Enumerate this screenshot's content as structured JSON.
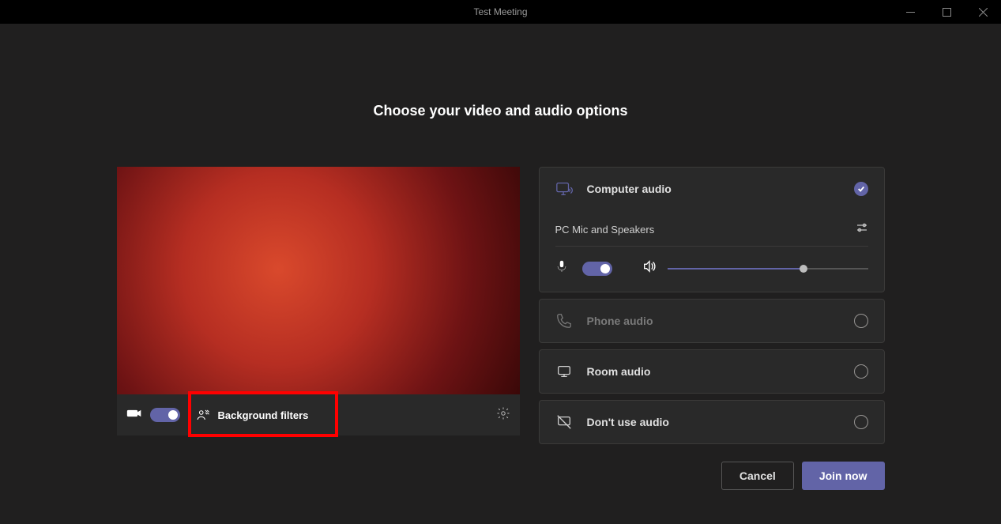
{
  "window": {
    "title": "Test Meeting"
  },
  "heading": "Choose your video and audio options",
  "video": {
    "camera_on": true,
    "bg_filters_label": "Background filters"
  },
  "audio_options": {
    "computer": {
      "label": "Computer audio",
      "selected": true
    },
    "device_label": "PC Mic and Speakers",
    "mic_on": true,
    "volume_percent": 68,
    "phone": {
      "label": "Phone audio",
      "enabled": false
    },
    "room": {
      "label": "Room audio",
      "enabled": true
    },
    "none": {
      "label": "Don't use audio",
      "enabled": true
    }
  },
  "footer": {
    "cancel": "Cancel",
    "join": "Join now"
  }
}
